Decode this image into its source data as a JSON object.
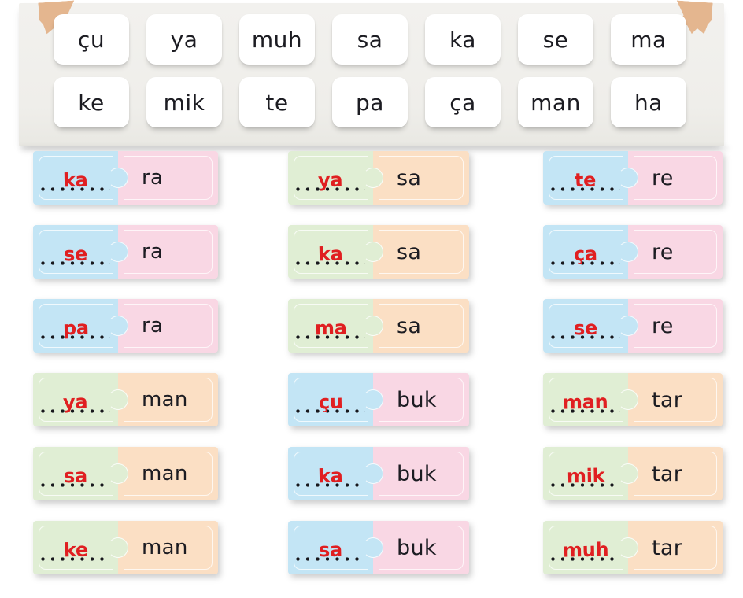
{
  "worksheet": {
    "accent_red": "#e01f21",
    "text_dark": "#1c1c22",
    "tape_color": "#e3b187",
    "panel_bg": "#f0efec",
    "tile_bg": "#ffffff"
  },
  "syllable_bank": {
    "row1": [
      "çu",
      "ya",
      "muh",
      "sa",
      "ka",
      "se",
      "ma"
    ],
    "row2": [
      "ke",
      "mik",
      "te",
      "pa",
      "ça",
      "man",
      "ha"
    ]
  },
  "colors": {
    "blue": "#c3e5f5",
    "pink": "#f9d7e4",
    "green": "#e0eed4",
    "orange": "#fbdfc4"
  },
  "columns": [
    {
      "id": "column-1",
      "pieces": [
        {
          "answer": "ka",
          "syllable": "ra",
          "theme": "blue-pink"
        },
        {
          "answer": "se",
          "syllable": "ra",
          "theme": "blue-pink"
        },
        {
          "answer": "pa",
          "syllable": "ra",
          "theme": "blue-pink"
        },
        {
          "answer": "ya",
          "syllable": "man",
          "theme": "green-orange"
        },
        {
          "answer": "sa",
          "syllable": "man",
          "theme": "green-orange"
        },
        {
          "answer": "ke",
          "syllable": "man",
          "theme": "green-orange"
        }
      ]
    },
    {
      "id": "column-2",
      "pieces": [
        {
          "answer": "ya",
          "syllable": "sa",
          "theme": "green-orange"
        },
        {
          "answer": "ka",
          "syllable": "sa",
          "theme": "green-orange"
        },
        {
          "answer": "ma",
          "syllable": "sa",
          "theme": "green-orange"
        },
        {
          "answer": "çu",
          "syllable": "buk",
          "theme": "blue-pink"
        },
        {
          "answer": "ka",
          "syllable": "buk",
          "theme": "blue-pink"
        },
        {
          "answer": "sa",
          "syllable": "buk",
          "theme": "blue-pink"
        }
      ]
    },
    {
      "id": "column-3",
      "pieces": [
        {
          "answer": "te",
          "syllable": "re",
          "theme": "blue-pink"
        },
        {
          "answer": "ça",
          "syllable": "re",
          "theme": "blue-pink"
        },
        {
          "answer": "se",
          "syllable": "re",
          "theme": "blue-pink"
        },
        {
          "answer": "man",
          "syllable": "tar",
          "theme": "green-orange"
        },
        {
          "answer": "mik",
          "syllable": "tar",
          "theme": "green-orange"
        },
        {
          "answer": "muh",
          "syllable": "tar",
          "theme": "green-orange"
        }
      ]
    }
  ]
}
